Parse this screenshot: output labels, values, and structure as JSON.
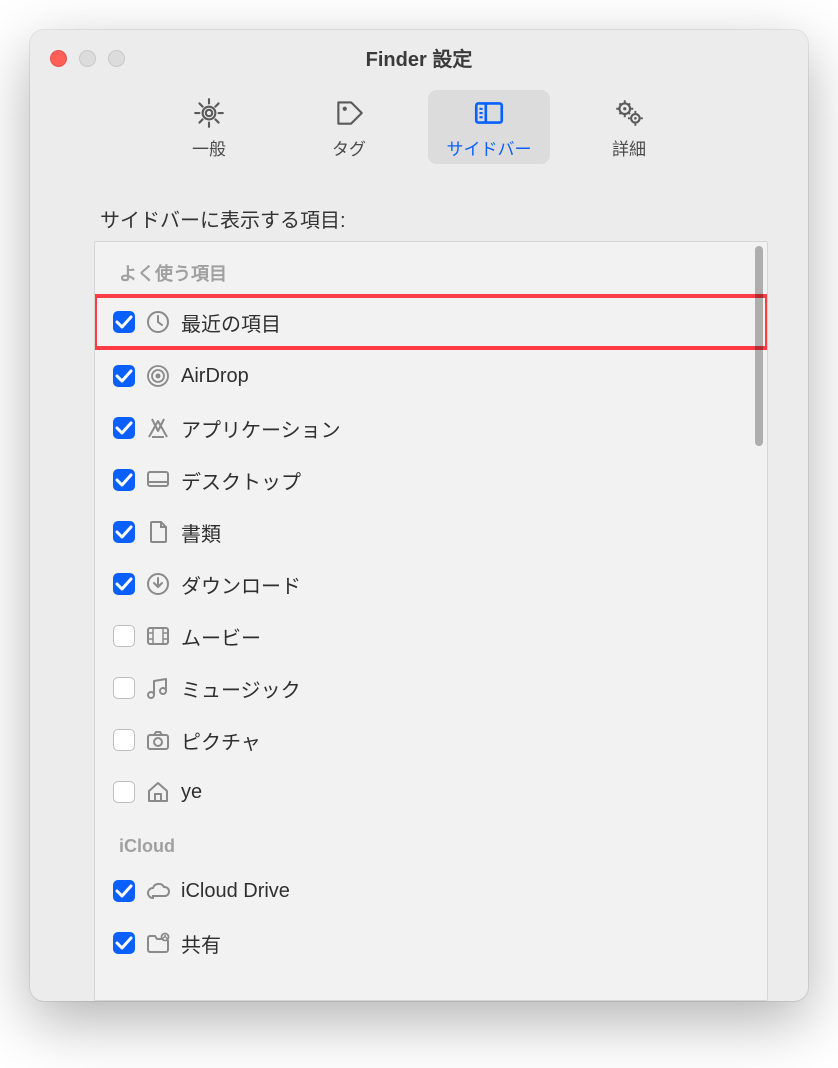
{
  "window": {
    "title": "Finder 設定"
  },
  "toolbar": {
    "items": [
      {
        "id": "general",
        "label": "一般",
        "icon": "gear-icon",
        "active": false
      },
      {
        "id": "tags",
        "label": "タグ",
        "icon": "tag-icon",
        "active": false
      },
      {
        "id": "sidebar",
        "label": "サイドバー",
        "icon": "sidebar-icon",
        "active": true
      },
      {
        "id": "advanced",
        "label": "詳細",
        "icon": "gears-icon",
        "active": false
      }
    ]
  },
  "section": {
    "label": "サイドバーに表示する項目:"
  },
  "groups": [
    {
      "header": "よく使う項目",
      "items": [
        {
          "checked": true,
          "icon": "clock-icon",
          "label": "最近の項目",
          "highlighted": true
        },
        {
          "checked": true,
          "icon": "airdrop-icon",
          "label": "AirDrop",
          "highlighted": false
        },
        {
          "checked": true,
          "icon": "applications-icon",
          "label": "アプリケーション",
          "highlighted": false
        },
        {
          "checked": true,
          "icon": "desktop-icon",
          "label": "デスクトップ",
          "highlighted": false
        },
        {
          "checked": true,
          "icon": "document-icon",
          "label": "書類",
          "highlighted": false
        },
        {
          "checked": true,
          "icon": "download-icon",
          "label": "ダウンロード",
          "highlighted": false
        },
        {
          "checked": false,
          "icon": "movie-icon",
          "label": "ムービー",
          "highlighted": false
        },
        {
          "checked": false,
          "icon": "music-icon",
          "label": "ミュージック",
          "highlighted": false
        },
        {
          "checked": false,
          "icon": "camera-icon",
          "label": "ピクチャ",
          "highlighted": false
        },
        {
          "checked": false,
          "icon": "home-icon",
          "label": "ye",
          "highlighted": false
        }
      ]
    },
    {
      "header": "iCloud",
      "items": [
        {
          "checked": true,
          "icon": "cloud-icon",
          "label": "iCloud Drive",
          "highlighted": false
        },
        {
          "checked": true,
          "icon": "shared-folder-icon",
          "label": "共有",
          "highlighted": false
        }
      ]
    }
  ]
}
